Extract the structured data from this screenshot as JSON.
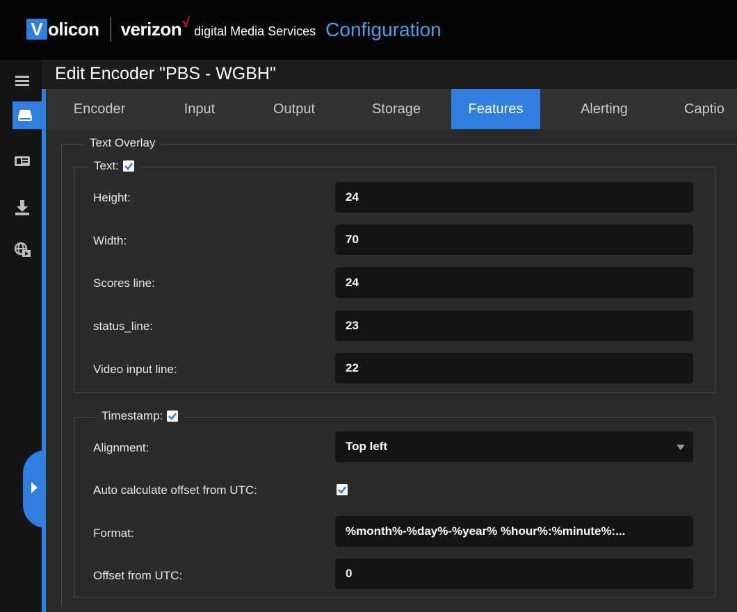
{
  "brand": {
    "volicon_v": "V",
    "volicon_rest": "olicon",
    "verizon": "verizon",
    "verizon_check": "√",
    "services": "digital Media Services",
    "app_title": "Configuration"
  },
  "page": {
    "title": "Edit Encoder \"PBS - WGBH\""
  },
  "tabs": [
    {
      "label": "Encoder",
      "active": false
    },
    {
      "label": "Input",
      "active": false
    },
    {
      "label": "Output",
      "active": false
    },
    {
      "label": "Storage",
      "active": false
    },
    {
      "label": "Features",
      "active": true
    },
    {
      "label": "Alerting",
      "active": false
    },
    {
      "label": "Captio",
      "active": false
    }
  ],
  "text_overlay": {
    "legend": "Text Overlay",
    "text_section": {
      "legend": "Text:",
      "checked": true,
      "fields": [
        {
          "label": "Height:",
          "value": "24"
        },
        {
          "label": "Width:",
          "value": "70"
        },
        {
          "label": "Scores line:",
          "value": "24"
        },
        {
          "label": "status_line:",
          "value": "23"
        },
        {
          "label": "Video input line:",
          "value": "22"
        }
      ]
    },
    "timestamp_section": {
      "legend": "Timestamp:",
      "checked": true,
      "alignment_label": "Alignment:",
      "alignment_value": "Top left",
      "auto_label": "Auto calculate offset from UTC:",
      "auto_checked": true,
      "format_label": "Format:",
      "format_value": "%month%-%day%-%year% %hour%:%minute%:...",
      "offset_label": "Offset from UTC:",
      "offset_value": "0"
    }
  },
  "colors": {
    "accent": "#2f7ee0",
    "background": "#2b2b2b",
    "field_bg": "#141414",
    "brand_red": "#e0161e"
  },
  "icons": [
    "menu-icon",
    "encoder-icon",
    "id-card-icon",
    "download-icon",
    "globe-video-icon",
    "expand-arrow-icon",
    "checkbox-icon",
    "dropdown-caret-icon"
  ]
}
